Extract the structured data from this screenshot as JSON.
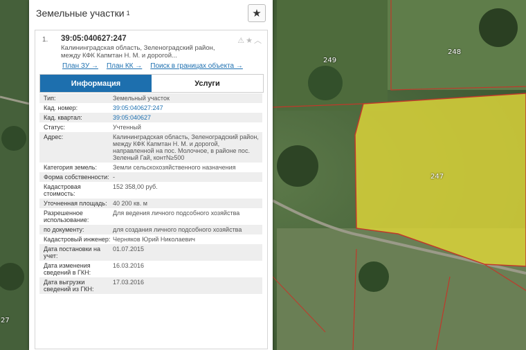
{
  "panel": {
    "title": "Земельные участки",
    "title_sup": "1",
    "star_icon": "star-icon"
  },
  "card": {
    "number": "1.",
    "cadastral_number": "39:05:040627:247",
    "address_short_line1": "Калининградская область, Зеленоградский район,",
    "address_short_line2": "между КФК Капмтан Н. М. и дорогой...",
    "links": [
      "План ЗУ →",
      "План КК →",
      "Поиск в границах объекта →"
    ]
  },
  "tabs": [
    {
      "label": "Информация",
      "active": true
    },
    {
      "label": "Услуги",
      "active": false
    }
  ],
  "properties": [
    {
      "key": "Тип:",
      "value": "Земельный участок"
    },
    {
      "key": "Кад. номер:",
      "value": "39:05:040627:247",
      "link": true
    },
    {
      "key": "Кад. квартал:",
      "value": "39:05:040627",
      "link": true
    },
    {
      "key": "Статус:",
      "value": "Учтенный"
    },
    {
      "key": "Адрес:",
      "value": "Калининградская область, Зеленоградский район, между КФК Капмтан Н. М. и дорогой, направленной на пос. Молочное, в районе пос. Зеленый Гай, контN≥500"
    },
    {
      "key": "Категория земель:",
      "value": "Земли сельскохозяйственного назначения"
    },
    {
      "key": "Форма собственности:",
      "value": "-"
    },
    {
      "key": "Кадастровая стоимость:",
      "value": "152 358,00 руб."
    },
    {
      "key": "Уточненная площадь:",
      "value": "40 200 кв. м"
    },
    {
      "key": "Разрешенное использование:",
      "value": "Для ведения личного подсобного хозяйства"
    },
    {
      "key": "по документу:",
      "value": "для создания личного подсобного хозяйства"
    },
    {
      "key": "Кадастровый инженер:",
      "value": "Черняков Юрий Николаевич"
    },
    {
      "key": "Дата постановки на учет:",
      "value": "01.07.2015"
    },
    {
      "key": "Дата изменения сведений в ГКН:",
      "value": "16.03.2016"
    },
    {
      "key": "Дата выгрузки сведений из ГКН:",
      "value": "17.03.2016"
    }
  ],
  "map": {
    "parcel_labels": [
      "249",
      "248",
      "247",
      "27"
    ],
    "highlight_color": "#d9d23a",
    "boundary_color": "#c0392b"
  }
}
